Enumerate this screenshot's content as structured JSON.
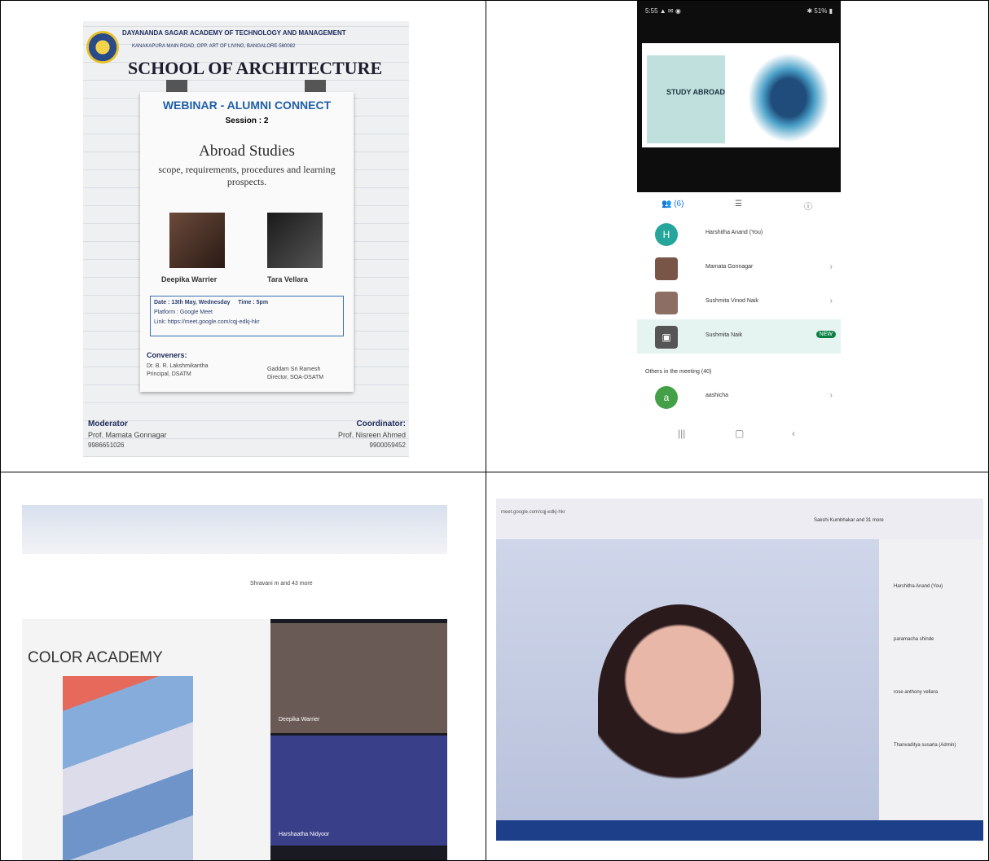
{
  "poster": {
    "institution": "DAYANANDA SAGAR ACADEMY OF TECHNOLOGY AND MANAGEMENT",
    "address": "KANAKAPURA MAIN ROAD, OPP. ART OF LIVING, BANGALORE-560082",
    "school": "SCHOOL OF ARCHITECTURE",
    "webinar_title": "WEBINAR - ALUMNI CONNECT",
    "session": "Session : 2",
    "topic": "Abroad Studies",
    "subtopic": "scope, requirements, procedures and learning prospects.",
    "speaker1": "Deepika Warrier",
    "speaker2": "Tara Vellara",
    "date_line": "Date : 13th May, Wednesday",
    "time_line": "Time : 5pm",
    "platform_line": "Platform : Google Meet",
    "link_line": "Link: https://meet.google.com/cqj-edkj-hkr",
    "conveners_label": "Conveners:",
    "convener1_name": "Dr. B. R. Lakshmikantha",
    "convener1_role": "Principal, DSATM",
    "convener2_name": "Gaddam Sri Ramesh",
    "convener2_role": "Director, SOA-DSATM",
    "moderator_label": "Moderator",
    "moderator_name": "Prof. Mamata Gonnagar",
    "moderator_phone": "9986651026",
    "coordinator_label": "Coordinator:",
    "coordinator_name": "Prof. Nisreen Ahmed",
    "coordinator_phone": "9900059452"
  },
  "phone": {
    "status_left": "5:55 ▲ ✉ ◉",
    "status_right": "✱ 51% ▮",
    "slide_label": "STUDY ABROAD",
    "tab_people": "👥 (6)",
    "participants": [
      {
        "initial": "H",
        "name": "Harshitha Anand (You)",
        "color": "#26a69a"
      },
      {
        "initial": "",
        "name": "Mamata Gonnagar",
        "color": "#795548"
      },
      {
        "initial": "",
        "name": "Sushmita Vinod Naik",
        "color": "#8d6e63"
      },
      {
        "initial": "▣",
        "name": "Sushmita Naik",
        "color": "#555555"
      }
    ],
    "presenting_badge": "NEW",
    "others_label": "Others in the meeting (40)",
    "other_participant": {
      "initial": "a",
      "name": "aashicha",
      "color": "#43a047"
    }
  },
  "screen3": {
    "slide_title": "COLOR ACADEMY",
    "people_tag": "Shravani m and 43 more",
    "tile1_name": "Deepika Warrier",
    "tile2_name": "Harshaatha Nidyoor"
  },
  "screen4": {
    "header": "meet.google.com/cqj-edkj-hkr",
    "people": "Sakshi Kumbhakar and 31 more",
    "side_names": [
      "Harshitha Anand (You)",
      "paramacha shinde",
      "rose anthony vellara",
      "Thanvaditya susarla (Admin)"
    ]
  }
}
